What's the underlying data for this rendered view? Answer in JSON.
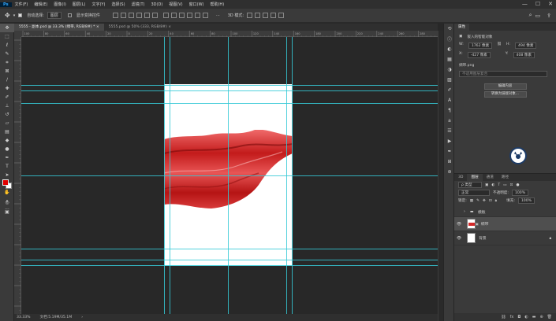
{
  "menubar": {
    "app_logo": "Ps",
    "items": [
      "文件(F)",
      "编辑(E)",
      "图像(I)",
      "图层(L)",
      "文字(Y)",
      "选择(S)",
      "滤镜(T)",
      "3D(D)",
      "视图(V)",
      "窗口(W)",
      "帮助(H)"
    ],
    "win_controls": [
      "—",
      "☐",
      "✕"
    ]
  },
  "optionsbar": {
    "auto_select_label": "自动选择:",
    "auto_select_value": "图层",
    "show_transform_label": "显示变换控件",
    "more": "···",
    "mode_3d": "3D 模式:"
  },
  "doctabs": [
    {
      "label": "5555 - 副本.psd @ 33.3% (绸带, RGB/8#) *",
      "active": true
    },
    {
      "label": "5555.psd @ 50% (333, RGB/8#)",
      "active": false
    }
  ],
  "ruler_top_labels": [
    "100",
    "80",
    "60",
    "40",
    "20",
    "0",
    "20",
    "40",
    "60",
    "80",
    "100",
    "120",
    "140",
    "160",
    "180",
    "200",
    "220",
    "240",
    "260",
    "280"
  ],
  "status": {
    "zoom": "33.33%",
    "doc_size": "文档:5.19M/35.1M"
  },
  "properties": {
    "tabs": [
      "属性"
    ],
    "type_label": "嵌入的智能对象",
    "w_label": "W:",
    "w_value": "1762 像素",
    "h_label": "H:",
    "h_value": "494 像素",
    "x_label": "X:",
    "x_value": "-427 像素",
    "y_label": "Y:",
    "y_value": "408 像素",
    "file_name": "绸带.png",
    "comp_placeholder": "不适用图层复合",
    "edit_button": "编辑内容",
    "convert_button": "转换为链接对象..."
  },
  "layers_panel": {
    "tabs": [
      "3D",
      "图层",
      "通道",
      "路径"
    ],
    "active_tab": "图层",
    "filter_kind": "ρ 类型",
    "blend_mode": "正常",
    "opacity_label": "不透明度:",
    "opacity_value": "100%",
    "lock_label": "锁定:",
    "fill_label": "填充:",
    "fill_value": "100%",
    "layers": [
      {
        "name": "模板",
        "kind": "group",
        "visible": false,
        "selected": false
      },
      {
        "name": "绸带",
        "kind": "smart",
        "visible": true,
        "selected": true
      },
      {
        "name": "背景",
        "kind": "background",
        "visible": true,
        "selected": false
      }
    ]
  },
  "colors": {
    "foreground": "#e10000",
    "background": "#ffffff",
    "guide": "#35c9d6",
    "canvas_bg": "#282828",
    "silk": "#d42a2a"
  }
}
